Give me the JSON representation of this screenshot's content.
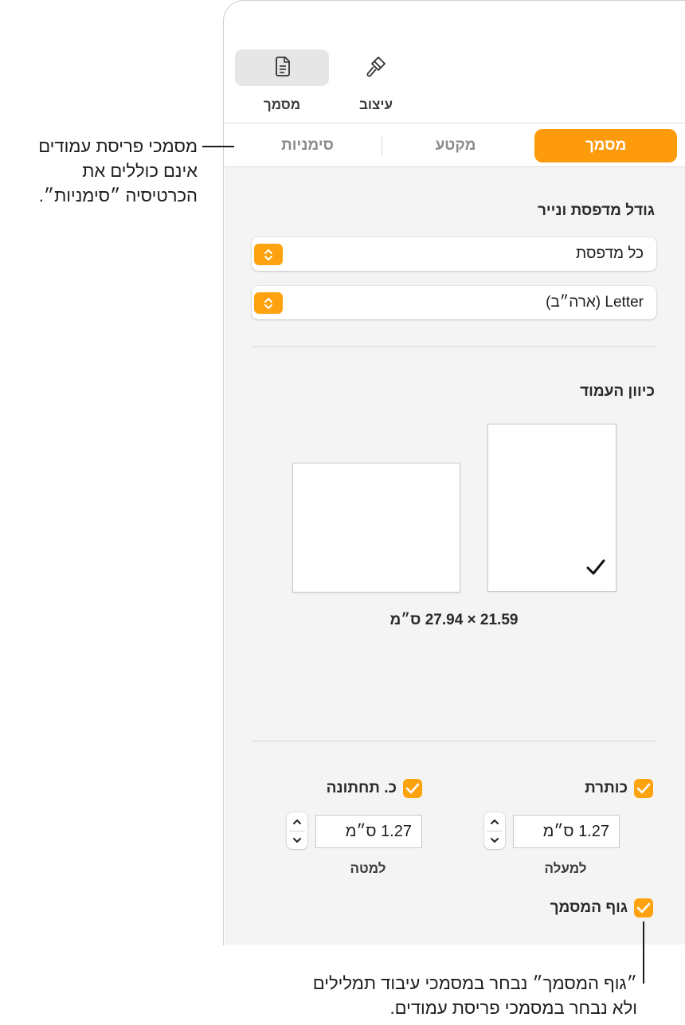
{
  "toolbar": {
    "format_label": "עיצוב",
    "document_label": "מסמך",
    "format_icon": "paintbrush-icon",
    "document_icon": "document-icon"
  },
  "tabs": [
    {
      "label": "מסמך",
      "active": true
    },
    {
      "label": "מקטע",
      "active": false
    },
    {
      "label": "סימניות",
      "active": false
    }
  ],
  "printer_paper": {
    "title": "גודל מדפסת ונייר",
    "printer_value": "כל מדפסת",
    "paper_value": "Letter (ארה״ב)"
  },
  "orientation": {
    "title": "כיוון העמוד",
    "selected": "portrait",
    "dimensions": "21.59 × 27.94 ס״מ"
  },
  "header_footer": {
    "header_label": "כותרת",
    "header_checked": true,
    "footer_label": "כ. תחתונה",
    "footer_checked": true,
    "top_value": "1.27 ס״מ",
    "top_label": "למעלה",
    "bottom_value": "1.27 ס״מ",
    "bottom_label": "למטה",
    "body_label": "גוף המסמך",
    "body_checked": true
  },
  "callouts": {
    "bookmarks_note": [
      "מסמכי פריסת עמודים",
      "אינם כוללים את",
      "הכרטיסיה ״סימניות״."
    ],
    "body_note": [
      "״גוף המסמך״ נבחר במסמכי עיבוד תמלילים",
      "ולא נבחר במסמכי פריסת עמודים."
    ]
  },
  "colors": {
    "accent": "#fe9b0c",
    "panel_background": "#f4f4f4"
  }
}
